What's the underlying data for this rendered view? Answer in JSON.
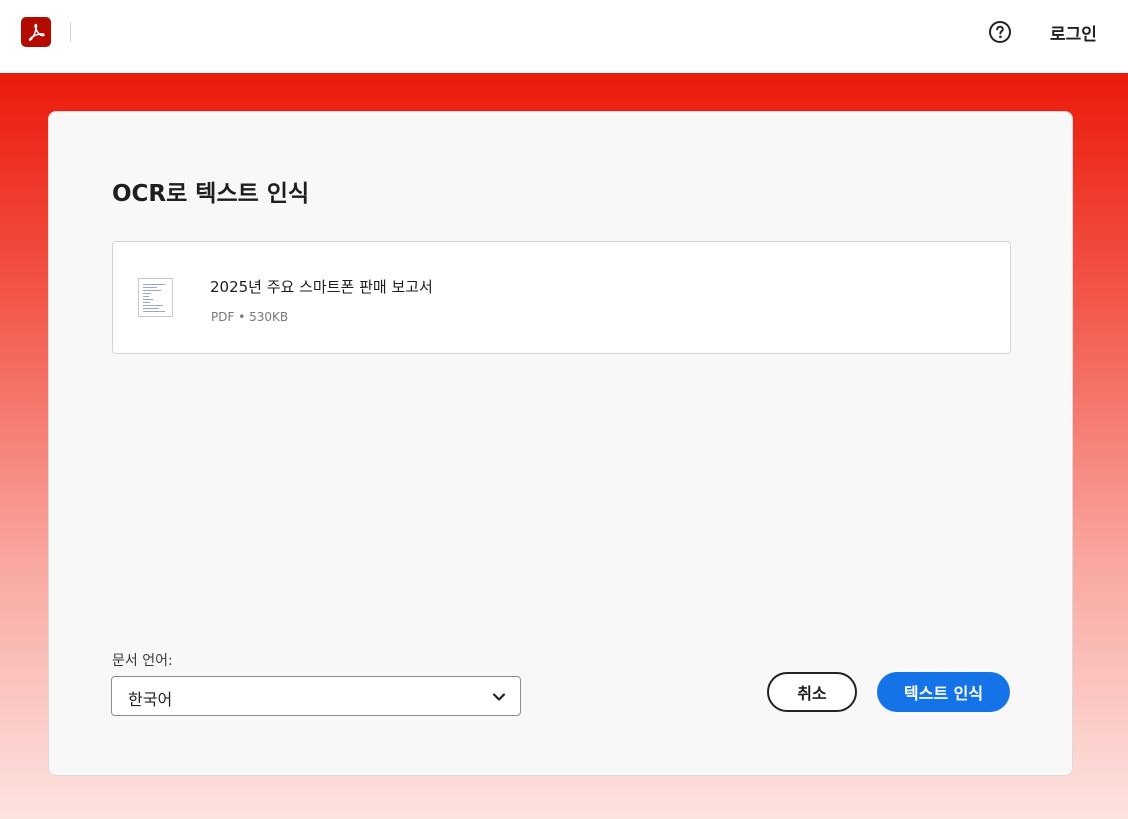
{
  "header": {
    "logo_icon": "adobe-acrobat-icon",
    "help_icon": "help-circle-icon",
    "login_label": "로그인"
  },
  "dialog": {
    "title": "OCR로 텍스트 인식",
    "file": {
      "name": "2025년 주요 스마트폰 판매 보고서",
      "meta": "PDF • 530KB",
      "thumbnail_icon": "document-thumbnail-icon"
    },
    "language": {
      "label": "문서 언어:",
      "selected": "한국어",
      "dropdown_icon": "chevron-down-icon"
    },
    "cancel_label": "취소",
    "submit_label": "텍스트 인식"
  },
  "colors": {
    "brand_red": "#ec1c0c",
    "primary_blue": "#1473e6",
    "logo_red": "#b30b00"
  }
}
